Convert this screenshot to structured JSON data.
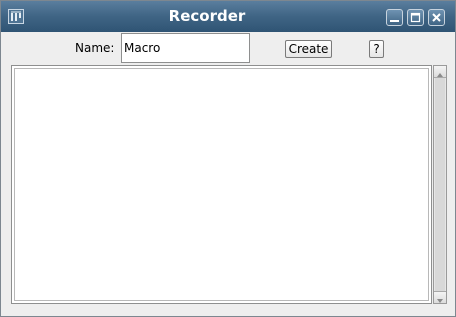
{
  "window": {
    "title": "Recorder",
    "app_icon": "imagej-icon",
    "controls": [
      "minimize-icon",
      "maximize-icon",
      "close-icon"
    ]
  },
  "toolbar": {
    "name_label": "Name:",
    "name_value": "Macro",
    "create_label": "Create",
    "help_label": "?"
  },
  "editor": {
    "content": ""
  },
  "colors": {
    "titlebar": "#3f6484",
    "window_bg": "#eeeeee"
  }
}
